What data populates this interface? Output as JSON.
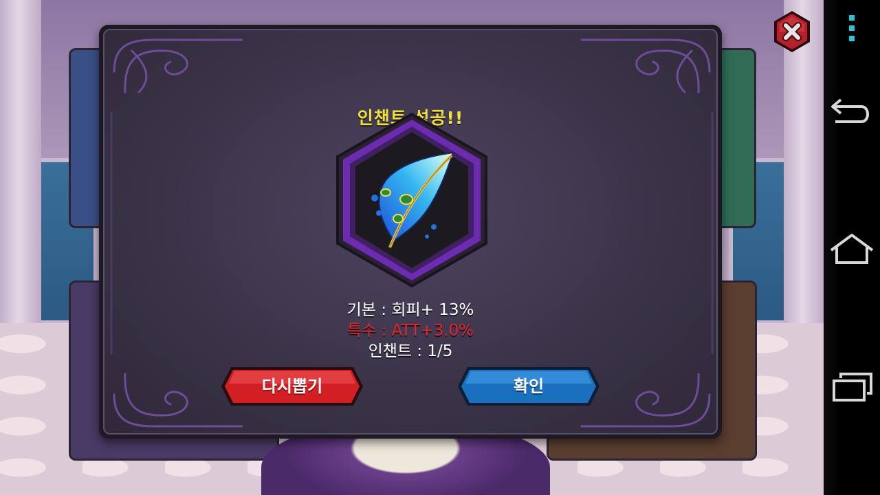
{
  "dialog": {
    "title": "인챈트 성공!!",
    "item": {
      "icon": "peacock-feather-icon"
    },
    "stats": {
      "base": "기본 : 회피+ 13%",
      "special": "특수 : ATT+3.0%",
      "enchant": "인챈트 : 1/5"
    },
    "buttons": {
      "redraw": "다시뽑기",
      "confirm": "확인"
    }
  },
  "close_button": {
    "icon": "close-icon"
  },
  "navbar": {
    "items": [
      {
        "icon": "menu-dots-icon"
      },
      {
        "icon": "back-icon"
      },
      {
        "icon": "home-icon"
      },
      {
        "icon": "recent-apps-icon"
      }
    ]
  },
  "colors": {
    "title": "#f0e13a",
    "special_stat": "#e5232a",
    "redraw_button": "#d11f24",
    "confirm_button": "#1a6fbf",
    "frame_purple": "#6c2bb0"
  }
}
